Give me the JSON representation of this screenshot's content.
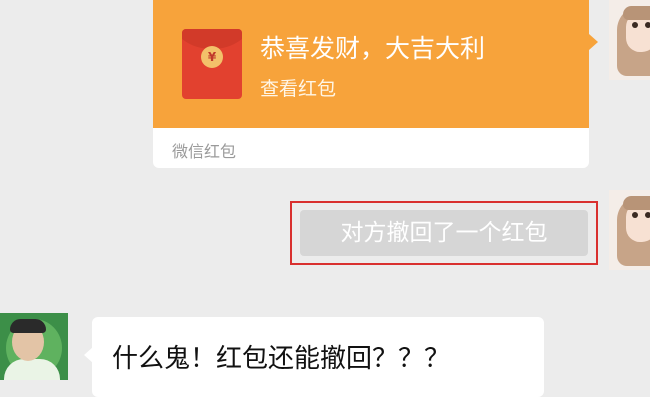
{
  "red_packet": {
    "greeting": "恭喜发财，大吉大利",
    "action": "查看红包",
    "brand": "微信红包",
    "coin_symbol": "¥"
  },
  "system_notice": {
    "text": "对方撤回了一个红包"
  },
  "incoming_message": {
    "text": "什么鬼！红包还能撤回？？？"
  },
  "colors": {
    "red_packet_orange": "#f7a33b",
    "envelope_red": "#e2412f",
    "highlight_border": "#d9302f",
    "notice_gray": "#d6d6d6",
    "chat_background": "#ececec"
  }
}
